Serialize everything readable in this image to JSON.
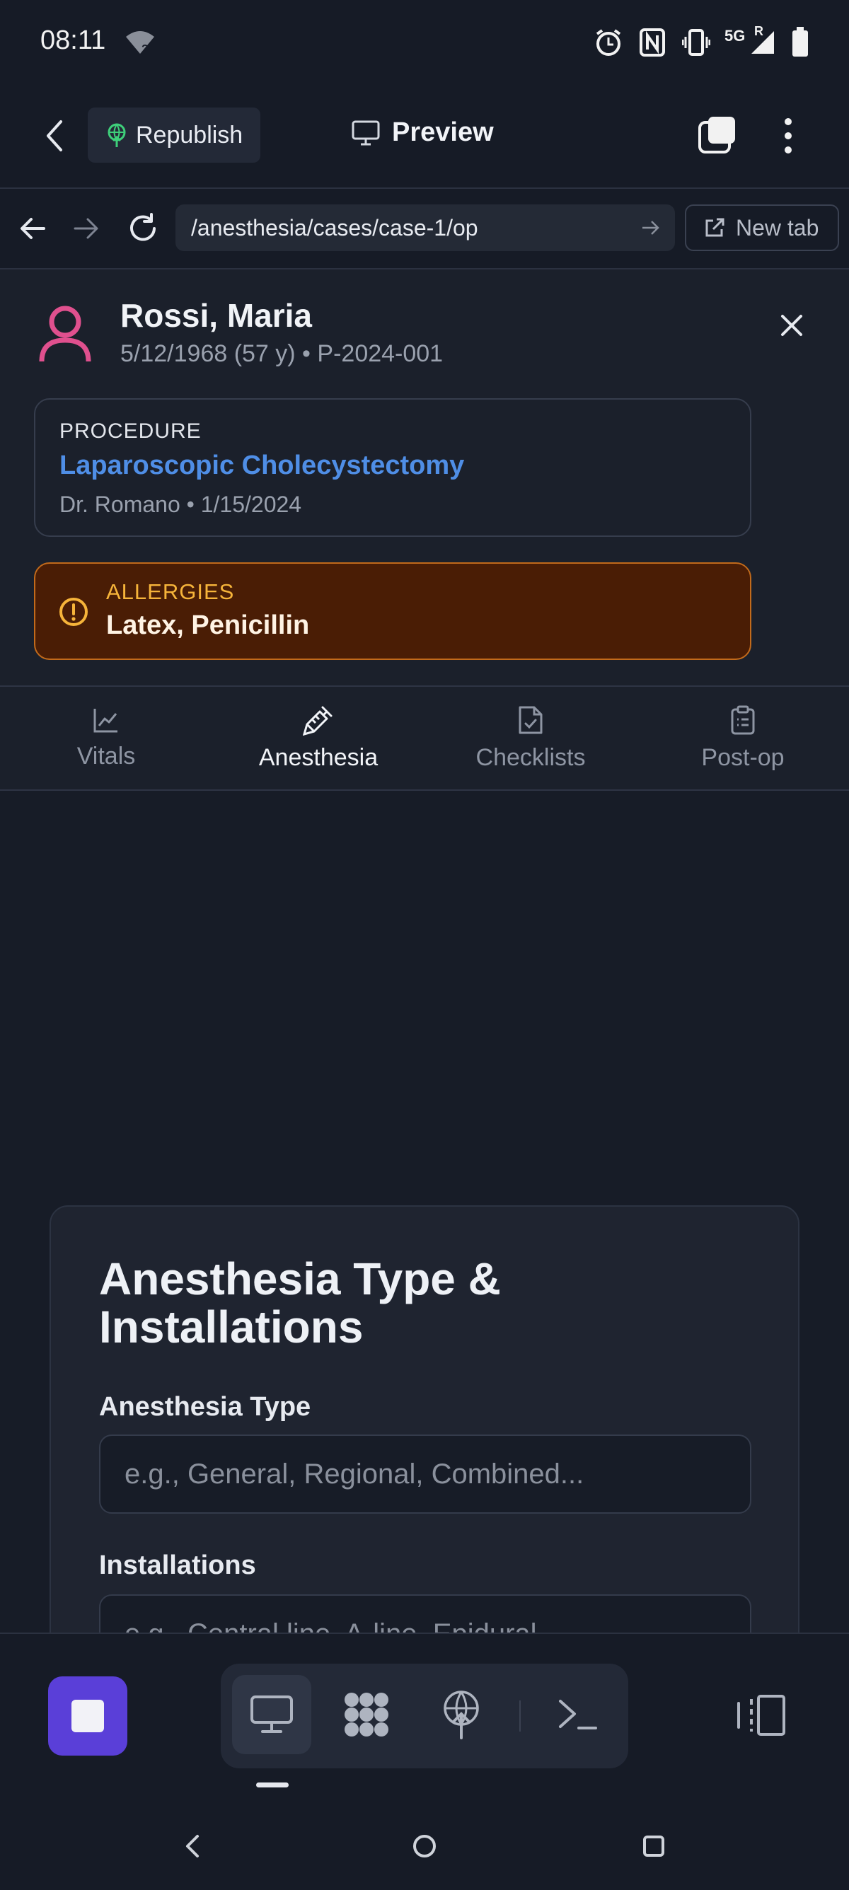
{
  "status_bar": {
    "time": "08:11",
    "network": "5G",
    "roaming": "R",
    "icons": [
      "wifi-unknown-icon",
      "alarm-icon",
      "nfc-icon",
      "vibrate-icon",
      "signal-icon",
      "battery-icon"
    ]
  },
  "app_toolbar": {
    "back_icon": "chevron-left-icon",
    "republish_label": "Republish",
    "preview_label": "Preview",
    "icons": [
      "globe-upload-icon",
      "monitor-icon",
      "tabs-icon",
      "more-vertical-icon"
    ]
  },
  "url_bar": {
    "url": "/anesthesia/cases/case-1/op",
    "new_tab_label": "New tab",
    "icons": [
      "arrow-left-icon",
      "arrow-right-icon",
      "reload-icon",
      "go-arrow-icon",
      "external-link-icon"
    ]
  },
  "patient": {
    "name": "Rossi, Maria",
    "meta": "5/12/1968 (57 y) • P-2024-001",
    "avatar_color": "#e0508e"
  },
  "procedure": {
    "label": "PROCEDURE",
    "name": "Laparoscopic Cholecystectomy",
    "meta": "Dr. Romano • 1/15/2024"
  },
  "allergies": {
    "label": "ALLERGIES",
    "value": "Latex, Penicillin"
  },
  "tabs": [
    {
      "label": "Vitals",
      "icon": "line-chart-icon",
      "active": false
    },
    {
      "label": "Anesthesia",
      "icon": "syringe-icon",
      "active": true
    },
    {
      "label": "Checklists",
      "icon": "file-check-icon",
      "active": false
    },
    {
      "label": "Post-op",
      "icon": "clipboard-list-icon",
      "active": false
    }
  ],
  "section": {
    "title": "Anesthesia Type & Installations",
    "fields": [
      {
        "label": "Anesthesia Type",
        "placeholder": "e.g., General, Regional, Combined..."
      },
      {
        "label": "Installations",
        "placeholder": "e.g., Central line, A-line, Epidural..."
      }
    ]
  },
  "dock": {
    "icons": [
      "stop-icon",
      "desktop-icon",
      "apps-icon",
      "deploy-icon",
      "terminal-icon",
      "split-view-icon"
    ]
  },
  "colors": {
    "background": "#161b26",
    "accent_blue": "#4f8ee6",
    "allergy_bg": "#4a1d05",
    "allergy_text": "#f6b43a",
    "stop_button": "#5a3fd8"
  }
}
